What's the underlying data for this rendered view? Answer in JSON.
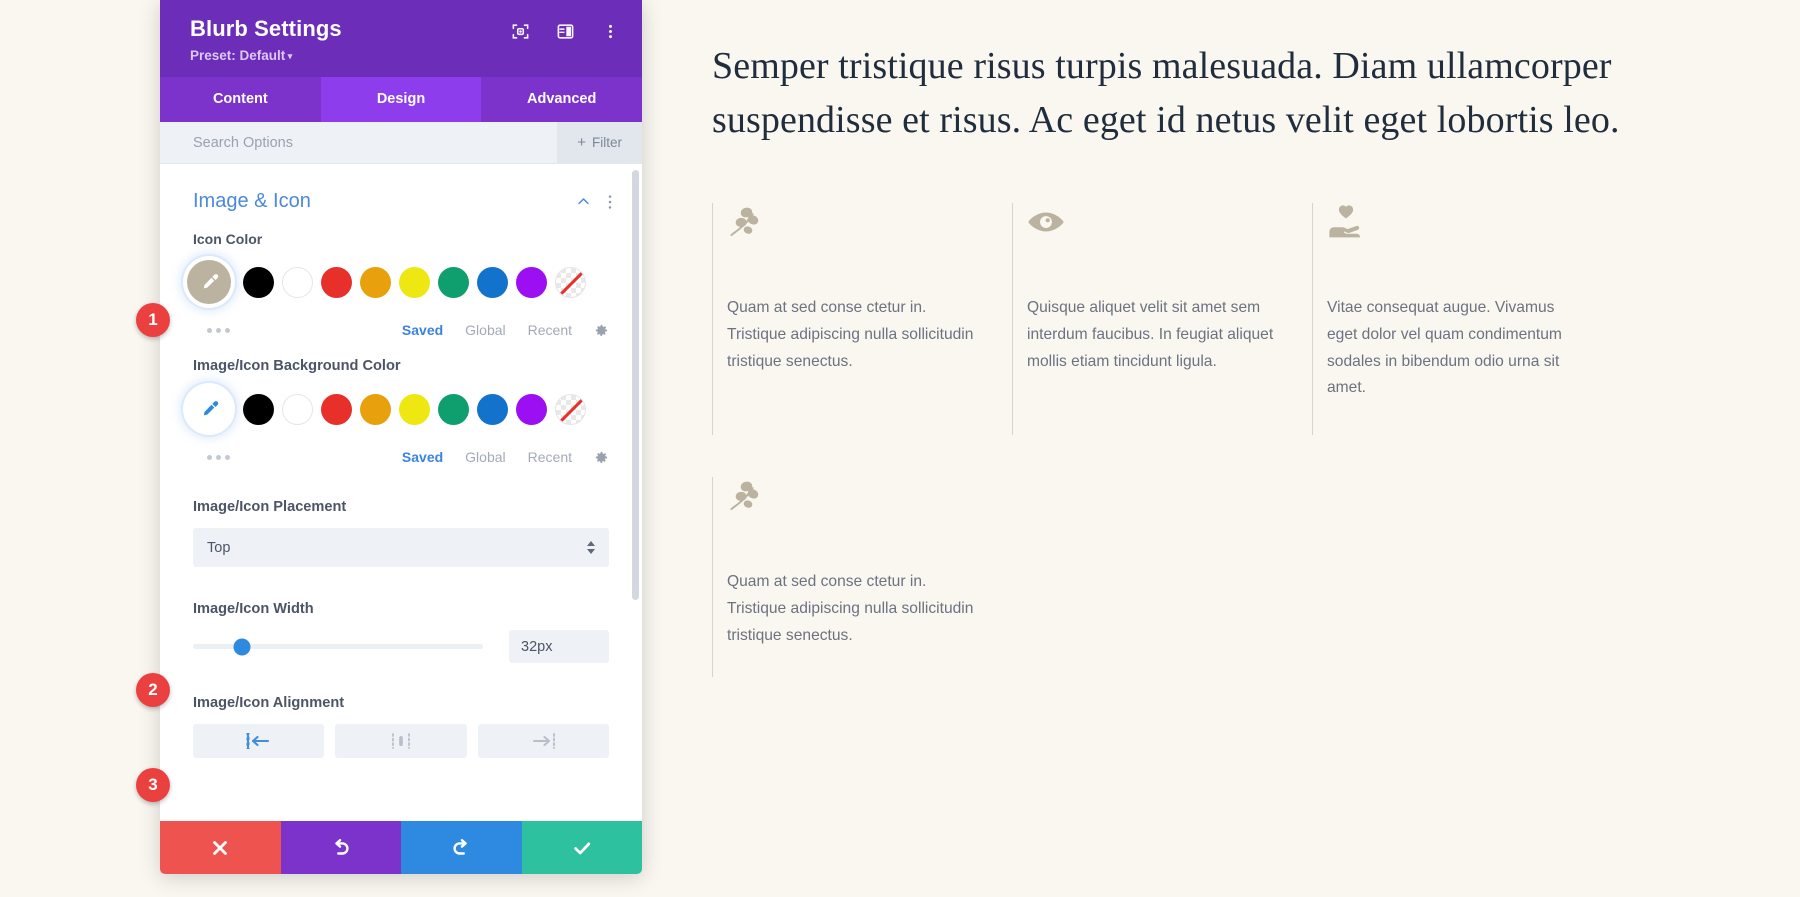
{
  "modal": {
    "title": "Blurb Settings",
    "preset_label": "Preset: Default",
    "header_icons": [
      {
        "name": "focus-target-icon"
      },
      {
        "name": "layout-panel-icon"
      },
      {
        "name": "more-vertical-icon"
      }
    ],
    "tabs": [
      {
        "label": "Content",
        "active": false
      },
      {
        "label": "Design",
        "active": true
      },
      {
        "label": "Advanced",
        "active": false
      }
    ],
    "search": {
      "placeholder": "Search Options",
      "value": ""
    },
    "filter_label": "Filter",
    "section": {
      "title": "Image & Icon"
    },
    "fields": {
      "icon_color": {
        "label": "Icon Color",
        "selected_color": "#bbb3a0",
        "swatches": [
          "#000000",
          "#ffffff",
          "#e8302a",
          "#e8a00c",
          "#efe711",
          "#0f9e6e",
          "#1373cc",
          "#9b0ff2",
          "none"
        ],
        "links": [
          {
            "label": "Saved",
            "active": true
          },
          {
            "label": "Global",
            "active": false
          },
          {
            "label": "Recent",
            "active": false
          }
        ]
      },
      "bg_color": {
        "label": "Image/Icon Background Color",
        "selected_color": "#ffffff",
        "swatches": [
          "#000000",
          "#ffffff",
          "#e8302a",
          "#e8a00c",
          "#efe711",
          "#0f9e6e",
          "#1373cc",
          "#9b0ff2",
          "none"
        ],
        "links": [
          {
            "label": "Saved",
            "active": true
          },
          {
            "label": "Global",
            "active": false
          },
          {
            "label": "Recent",
            "active": false
          }
        ]
      },
      "placement": {
        "label": "Image/Icon Placement",
        "value": "Top"
      },
      "width": {
        "label": "Image/Icon Width",
        "value": "32px",
        "slider_percent": 17
      },
      "alignment": {
        "label": "Image/Icon Alignment",
        "options": [
          {
            "name": "align-left",
            "active": true
          },
          {
            "name": "align-center",
            "active": false
          },
          {
            "name": "align-right",
            "active": false
          }
        ]
      }
    },
    "actions": [
      {
        "name": "cancel-button",
        "color": "#ef5350"
      },
      {
        "name": "undo-button",
        "color": "#7b33cc"
      },
      {
        "name": "redo-button",
        "color": "#2d8ae0"
      },
      {
        "name": "save-button",
        "color": "#2ec19f"
      }
    ],
    "badges": [
      "1",
      "2",
      "3"
    ]
  },
  "page": {
    "heading": "Semper tristique risus turpis malesuada. Diam ullamcorper suspendisse et risus. Ac eget id netus velit eget lobortis leo.",
    "blurbs": [
      {
        "icon": "leaf-branch-icon",
        "text": "Quam at sed conse ctetur in. Tristique adipiscing nulla sollicitudin tristique senectus."
      },
      {
        "icon": "eye-icon",
        "text": "Quisque aliquet velit sit amet sem interdum faucibus. In feugiat aliquet mollis etiam tincidunt ligula."
      },
      {
        "icon": "heart-hand-icon",
        "text": "Vitae consequat augue. Vivamus eget dolor vel quam condimentum sodales in bibendum odio urna sit amet."
      },
      {
        "icon": "leaf-branch-icon",
        "text": "Quam at sed conse ctetur in. Tristique adipiscing nulla sollicitudin tristique senectus."
      }
    ],
    "icon_color": "#bbb3a0"
  }
}
